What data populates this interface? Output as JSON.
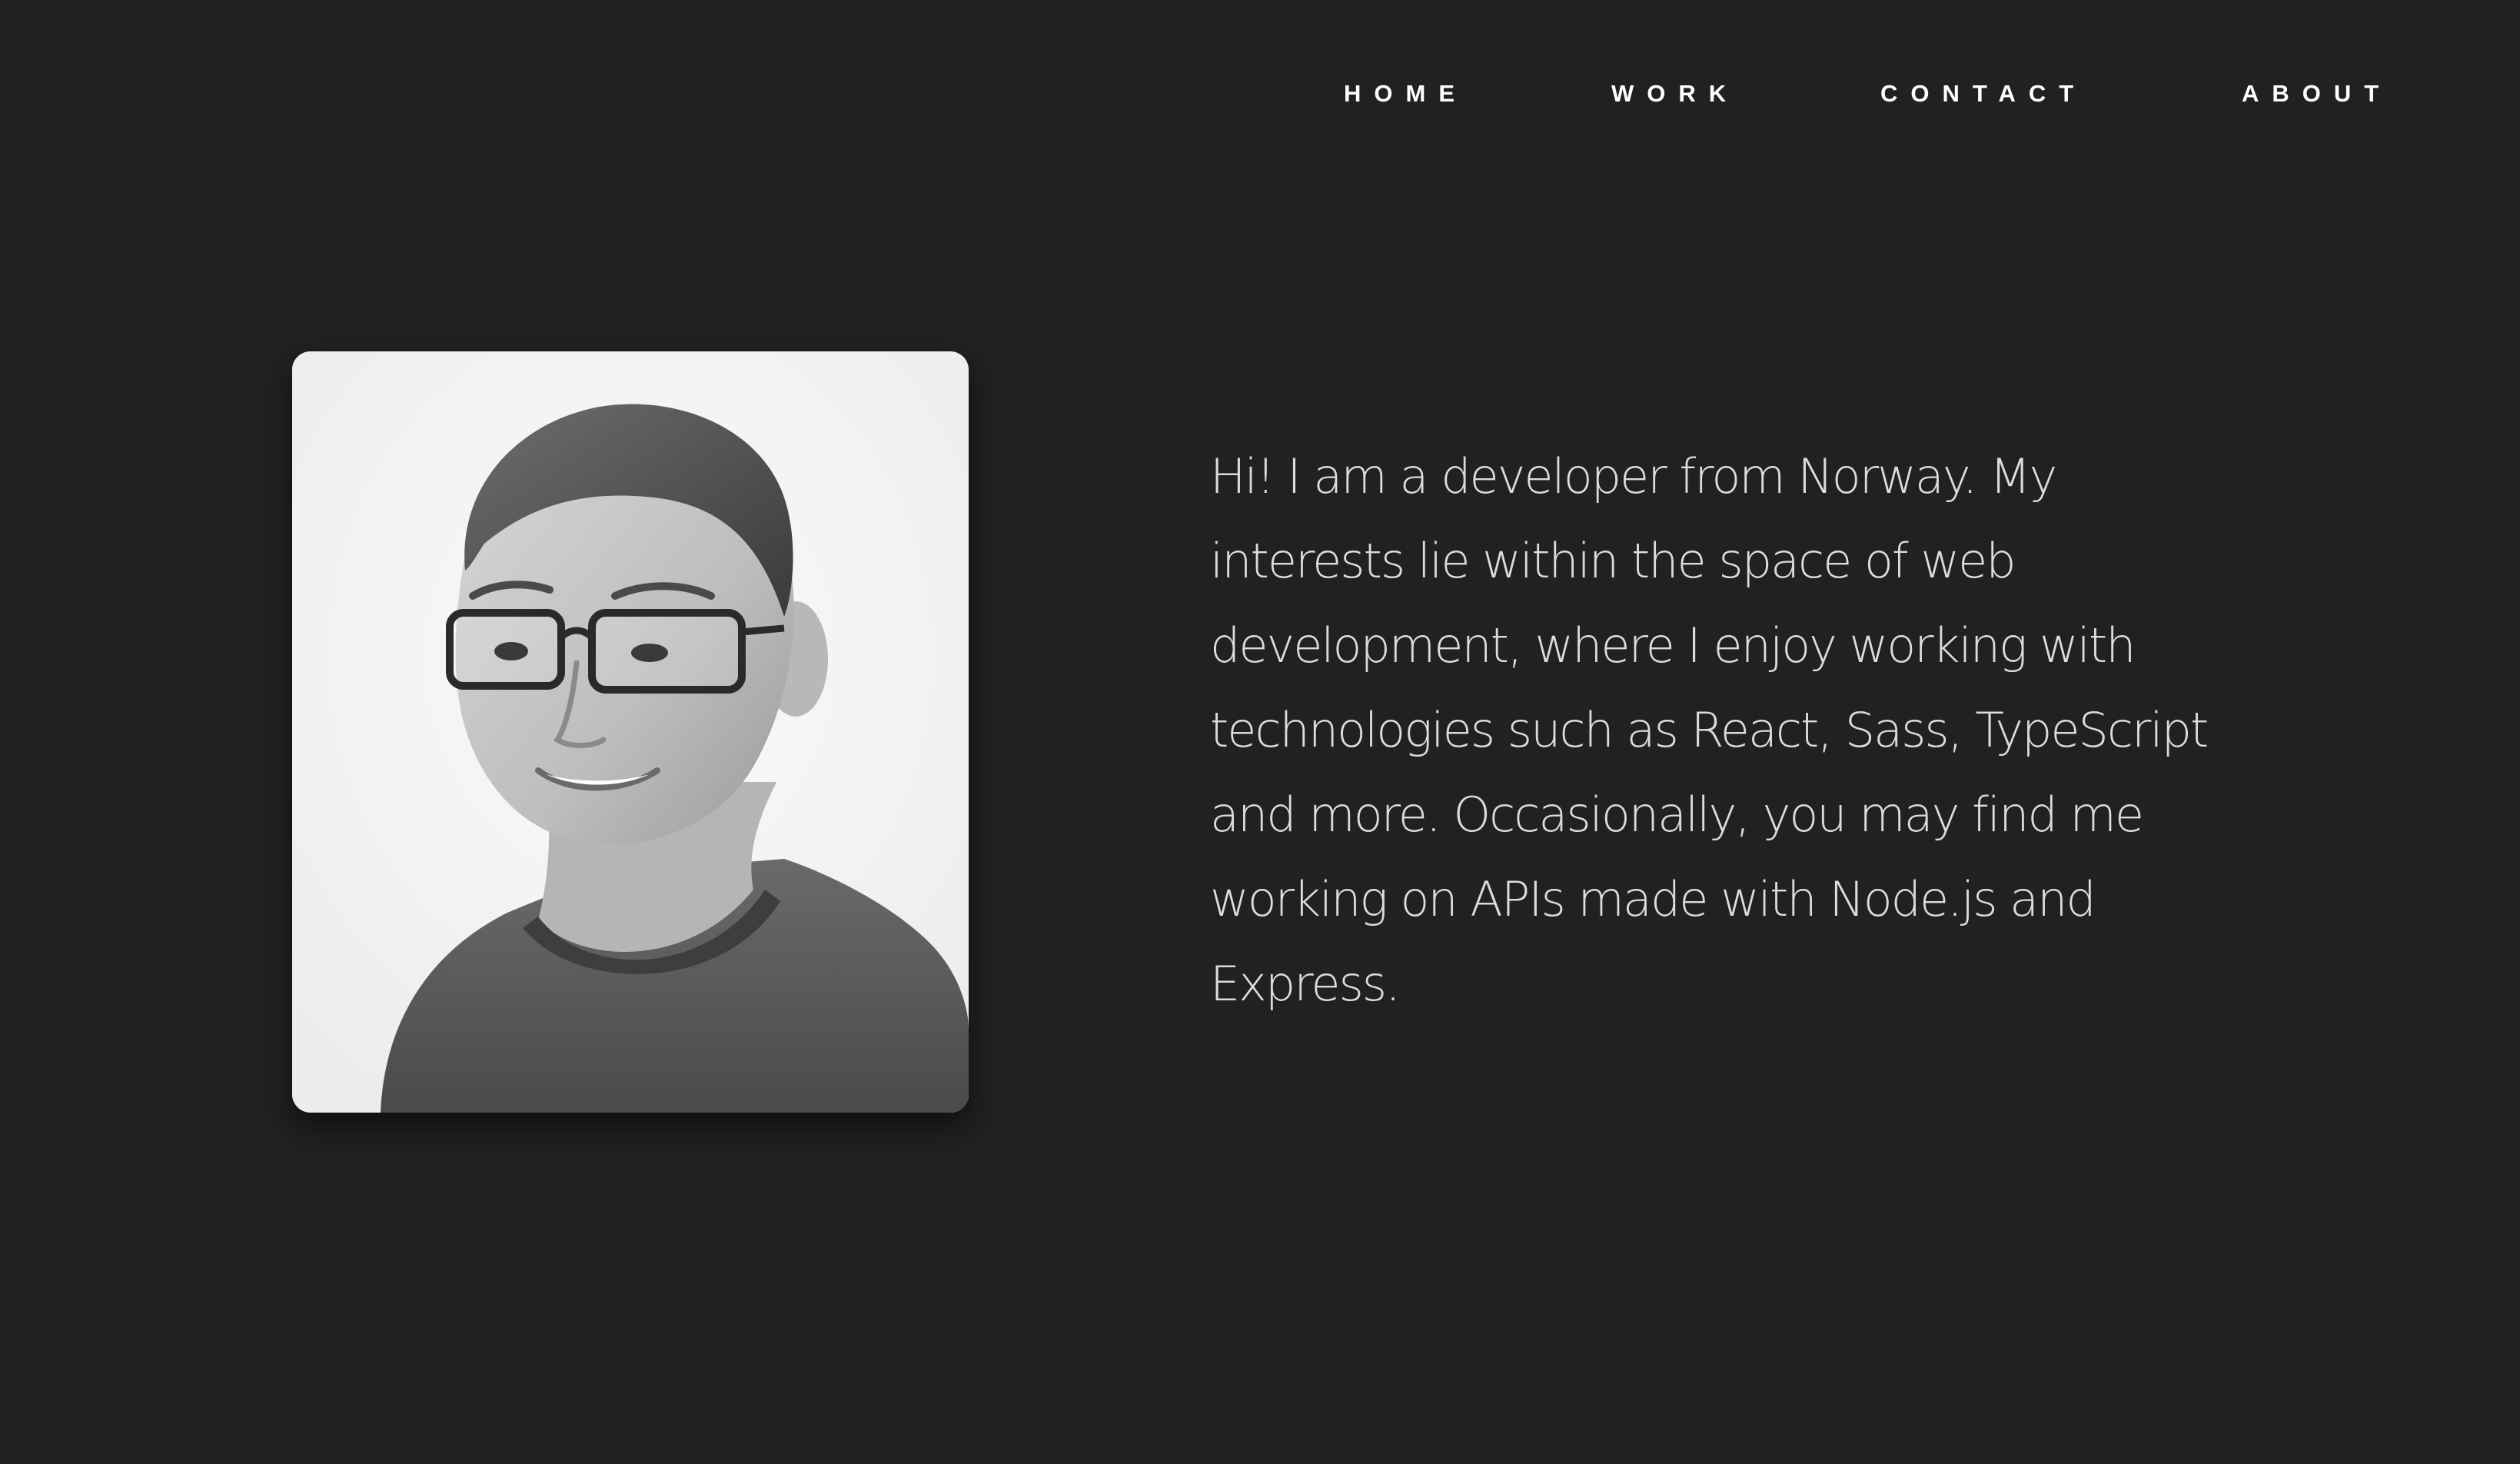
{
  "nav": {
    "items": [
      {
        "label": "HOME"
      },
      {
        "label": "WORK"
      },
      {
        "label": "CONTACT"
      },
      {
        "label": "ABOUT"
      }
    ]
  },
  "profile": {
    "bio": "Hi! I am a developer from Norway. My interests lie within the space of web development, where I enjoy working with technologies such as React, Sass, TypeScript and more. Occasionally, you may find me working on APIs made with Node.js and Express."
  },
  "colors": {
    "background": "#212121",
    "nav_text": "#ffffff",
    "bio_text": "#dcdcdc",
    "photo_background": "#f7f7f7"
  }
}
